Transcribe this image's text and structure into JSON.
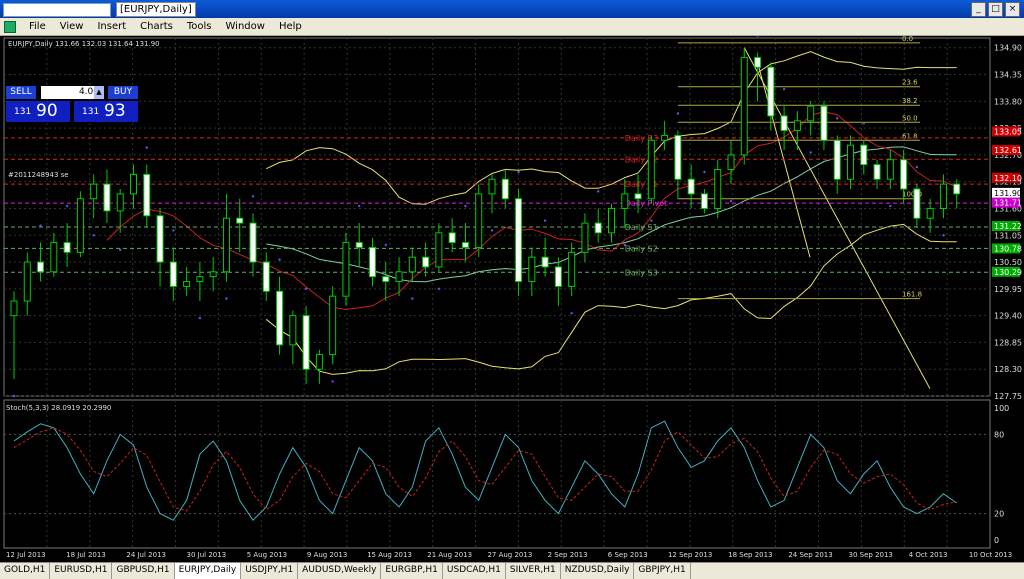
{
  "window": {
    "title": "[EURJPY,Daily]",
    "buttons": {
      "minimize": "_",
      "maximize": "□",
      "close": "×"
    }
  },
  "menu": [
    "File",
    "View",
    "Insert",
    "Charts",
    "Tools",
    "Window",
    "Help"
  ],
  "chart_header": "EURJPY,Daily  131.66 132.03 131.64 131.90",
  "trade": {
    "sell": "SELL",
    "buy": "BUY",
    "lot": "4.00",
    "bid_prefix": "131",
    "bid_big": "90",
    "ask_prefix": "131",
    "ask_big": "93"
  },
  "order_label": "#2011248943 se",
  "price_labels": [
    {
      "text": "134.90",
      "price": 134.9
    },
    {
      "text": "134.35",
      "price": 134.35
    },
    {
      "text": "133.80",
      "price": 133.8
    },
    {
      "text": "133.25",
      "price": 133.25
    },
    {
      "text": "132.70",
      "price": 132.7
    },
    {
      "text": "132.15",
      "price": 132.15
    },
    {
      "text": "131.60",
      "price": 131.6
    },
    {
      "text": "131.05",
      "price": 131.05
    },
    {
      "text": "130.50",
      "price": 130.5
    },
    {
      "text": "129.95",
      "price": 129.95
    },
    {
      "text": "129.40",
      "price": 129.4
    },
    {
      "text": "128.85",
      "price": 128.85
    },
    {
      "text": "128.30",
      "price": 128.3
    },
    {
      "text": "127.75",
      "price": 127.75
    }
  ],
  "price_tags": [
    {
      "text": "133.05",
      "price": 133.18,
      "color": "#cc0000"
    },
    {
      "text": "132.61",
      "price": 132.8,
      "color": "#cc0000"
    },
    {
      "text": "132.10",
      "price": 132.23,
      "color": "#cc0000"
    },
    {
      "text": "131.90",
      "price": 131.92,
      "color": "#ffffff"
    },
    {
      "text": "131.71",
      "price": 131.72,
      "color": "#cc00cc"
    },
    {
      "text": "131.22",
      "price": 131.24,
      "color": "#00aa00"
    },
    {
      "text": "130.78",
      "price": 130.78,
      "color": "#00aa00"
    },
    {
      "text": "130.29",
      "price": 130.3,
      "color": "#00aa00"
    }
  ],
  "pivot_labels": [
    {
      "text": "Daily R3",
      "price": 133.05,
      "color": "#dd2222"
    },
    {
      "text": "Daily R2",
      "price": 132.61,
      "color": "#dd2222"
    },
    {
      "text": "Daily R1",
      "price": 132.1,
      "color": "#dd2222"
    },
    {
      "text": "Daily Pivot",
      "price": 131.71,
      "color": "#dd22dd"
    },
    {
      "text": "Daily S1",
      "price": 131.22,
      "color": "#66aa66"
    },
    {
      "text": "Daily S2",
      "price": 130.78,
      "color": "#66aa66"
    },
    {
      "text": "Daily S3",
      "price": 130.29,
      "color": "#66aa66"
    }
  ],
  "fib_labels": [
    {
      "text": "0.0",
      "price": 135.0
    },
    {
      "text": "23.6",
      "price": 134.1
    },
    {
      "text": "38.2",
      "price": 133.72
    },
    {
      "text": "50.0",
      "price": 133.37
    },
    {
      "text": "61.8",
      "price": 133.0
    },
    {
      "text": "100.0",
      "price": 131.8
    },
    {
      "text": "161.8",
      "price": 129.75
    }
  ],
  "stoch_header": "Stoch(5,3,3) 28.0919 20.2990",
  "stoch_levels": [
    "100",
    "80",
    "20",
    "0"
  ],
  "date_labels": [
    "12 Jul 2013",
    "18 Jul 2013",
    "24 Jul 2013",
    "30 Jul 2013",
    "5 Aug 2013",
    "9 Aug 2013",
    "15 Aug 2013",
    "21 Aug 2013",
    "27 Aug 2013",
    "2 Sep 2013",
    "6 Sep 2013",
    "12 Sep 2013",
    "18 Sep 2013",
    "24 Sep 2013",
    "30 Sep 2013",
    "4 Oct 2013",
    "10 Oct 2013"
  ],
  "tabs": [
    "GOLD,H1",
    "EURUSD,H1",
    "GBPUSD,H1",
    "EURJPY,Daily",
    "USDJPY,H1",
    "AUDUSD,Weekly",
    "EURGBP,H1",
    "USDCAD,H1",
    "SILVER,H1",
    "NZDUSD,Daily",
    "GBPJPY,H1"
  ],
  "active_tab": "EURJPY,Daily",
  "colors": {
    "bull": "#00cc00",
    "bear": "#ffffff",
    "grid": "#2a3a2a",
    "bands": "#e8e070",
    "ma_red": "#cc2020",
    "ma_green": "#80d0a0",
    "stoch_main": "#40b0c0",
    "stoch_signal": "#cc2020"
  },
  "chart_data": {
    "type": "candlestick",
    "symbol": "EURJPY",
    "timeframe": "Daily",
    "ohlc": [
      [
        129.4,
        129.9,
        128.1,
        129.7
      ],
      [
        129.7,
        130.7,
        129.4,
        130.5
      ],
      [
        130.5,
        130.9,
        130.1,
        130.3
      ],
      [
        130.3,
        131.1,
        130.2,
        130.9
      ],
      [
        130.9,
        131.3,
        130.4,
        130.7
      ],
      [
        130.7,
        131.95,
        130.6,
        131.8
      ],
      [
        131.8,
        132.3,
        131.4,
        132.1
      ],
      [
        132.1,
        132.4,
        131.3,
        131.55
      ],
      [
        131.55,
        132.0,
        131.1,
        131.9
      ],
      [
        131.9,
        132.5,
        131.6,
        132.3
      ],
      [
        132.3,
        132.5,
        131.2,
        131.45
      ],
      [
        131.45,
        131.6,
        130.0,
        130.5
      ],
      [
        130.5,
        130.8,
        129.7,
        130.0
      ],
      [
        130.0,
        130.4,
        129.8,
        130.1
      ],
      [
        130.1,
        130.5,
        129.7,
        130.2
      ],
      [
        130.2,
        130.6,
        129.9,
        130.3
      ],
      [
        130.3,
        131.9,
        130.1,
        131.4
      ],
      [
        131.4,
        131.8,
        130.7,
        131.3
      ],
      [
        131.3,
        131.5,
        130.2,
        130.5
      ],
      [
        130.5,
        130.7,
        129.7,
        129.9
      ],
      [
        129.9,
        130.2,
        128.6,
        128.8
      ],
      [
        128.8,
        129.5,
        128.4,
        129.4
      ],
      [
        129.4,
        129.6,
        128.0,
        128.3
      ],
      [
        128.3,
        128.7,
        128.0,
        128.6
      ],
      [
        128.6,
        130.0,
        128.4,
        129.8
      ],
      [
        129.8,
        131.1,
        129.6,
        130.9
      ],
      [
        130.9,
        131.3,
        130.4,
        130.8
      ],
      [
        130.8,
        131.0,
        130.0,
        130.2
      ],
      [
        130.2,
        130.5,
        129.7,
        130.1
      ],
      [
        130.1,
        130.6,
        129.8,
        130.3
      ],
      [
        130.3,
        130.8,
        130.1,
        130.6
      ],
      [
        130.6,
        130.9,
        130.2,
        130.4
      ],
      [
        130.4,
        131.3,
        130.3,
        131.1
      ],
      [
        131.1,
        131.4,
        130.7,
        130.9
      ],
      [
        130.9,
        131.3,
        130.5,
        130.8
      ],
      [
        130.8,
        132.1,
        130.6,
        131.9
      ],
      [
        131.9,
        132.3,
        131.5,
        132.2
      ],
      [
        132.2,
        132.4,
        131.6,
        131.8
      ],
      [
        131.8,
        132.0,
        129.8,
        130.1
      ],
      [
        130.1,
        130.8,
        129.8,
        130.6
      ],
      [
        130.6,
        131.0,
        130.2,
        130.4
      ],
      [
        130.4,
        130.6,
        129.6,
        130.0
      ],
      [
        130.0,
        130.9,
        129.8,
        130.7
      ],
      [
        130.7,
        131.5,
        130.5,
        131.3
      ],
      [
        131.3,
        131.6,
        130.9,
        131.1
      ],
      [
        131.1,
        131.7,
        130.9,
        131.6
      ],
      [
        131.6,
        132.2,
        131.2,
        131.9
      ],
      [
        131.9,
        132.3,
        131.5,
        131.8
      ],
      [
        131.8,
        133.1,
        131.7,
        133.0
      ],
      [
        133.0,
        133.4,
        132.8,
        133.1
      ],
      [
        133.1,
        133.2,
        131.8,
        132.2
      ],
      [
        132.2,
        132.5,
        131.6,
        131.9
      ],
      [
        131.9,
        132.0,
        131.5,
        131.6
      ],
      [
        131.6,
        132.6,
        131.4,
        132.4
      ],
      [
        132.4,
        133.0,
        132.1,
        132.7
      ],
      [
        132.7,
        134.9,
        132.5,
        134.7
      ],
      [
        134.7,
        134.8,
        133.8,
        134.5
      ],
      [
        134.5,
        134.6,
        133.2,
        133.5
      ],
      [
        133.5,
        133.7,
        132.8,
        133.2
      ],
      [
        133.2,
        133.6,
        132.8,
        133.4
      ],
      [
        133.4,
        133.8,
        133.1,
        133.7
      ],
      [
        133.7,
        133.8,
        132.8,
        133.0
      ],
      [
        133.0,
        133.1,
        131.9,
        132.2
      ],
      [
        132.2,
        133.1,
        132.0,
        132.9
      ],
      [
        132.9,
        133.0,
        132.3,
        132.5
      ],
      [
        132.5,
        132.6,
        132.0,
        132.2
      ],
      [
        132.2,
        132.8,
        132.0,
        132.6
      ],
      [
        132.6,
        132.8,
        131.7,
        132.0
      ],
      [
        132.0,
        132.1,
        131.2,
        131.4
      ],
      [
        131.4,
        131.8,
        131.1,
        131.6
      ],
      [
        131.6,
        132.3,
        131.4,
        132.1
      ],
      [
        132.1,
        132.2,
        131.6,
        131.9
      ]
    ],
    "ylim": [
      127.75,
      135.1
    ],
    "stoch_main": [
      75,
      82,
      88,
      85,
      70,
      50,
      35,
      60,
      80,
      72,
      40,
      20,
      15,
      30,
      65,
      75,
      60,
      30,
      15,
      25,
      50,
      70,
      55,
      30,
      20,
      45,
      70,
      60,
      35,
      25,
      40,
      75,
      85,
      65,
      40,
      30,
      55,
      80,
      70,
      45,
      30,
      20,
      40,
      60,
      50,
      35,
      25,
      50,
      85,
      90,
      70,
      55,
      60,
      75,
      85,
      70,
      45,
      25,
      30,
      55,
      80,
      70,
      45,
      35,
      50,
      60,
      40,
      25,
      20,
      25,
      35,
      28
    ],
    "stoch_signal": [
      70,
      76,
      82,
      85,
      80,
      68,
      52,
      48,
      58,
      70,
      64,
      44,
      25,
      22,
      37,
      57,
      67,
      55,
      35,
      23,
      30,
      48,
      58,
      52,
      35,
      32,
      45,
      58,
      55,
      40,
      33,
      47,
      67,
      75,
      63,
      45,
      42,
      55,
      68,
      65,
      48,
      32,
      30,
      40,
      50,
      48,
      37,
      37,
      53,
      75,
      82,
      72,
      62,
      63,
      73,
      77,
      67,
      47,
      33,
      37,
      55,
      68,
      65,
      50,
      43,
      48,
      50,
      42,
      28,
      23,
      27,
      29
    ],
    "stoch_ylim": [
      0,
      100
    ]
  }
}
